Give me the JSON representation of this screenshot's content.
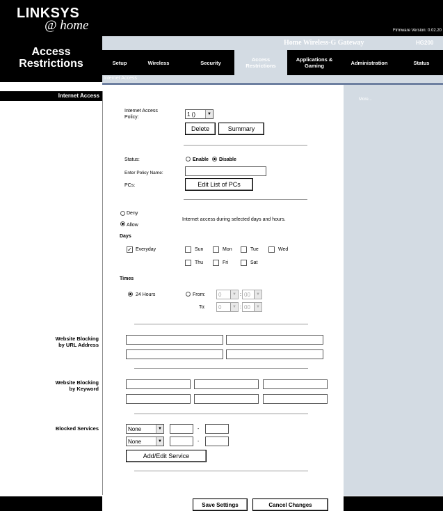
{
  "header": {
    "logo_main": "LINKSYS",
    "logo_sub": "@ home",
    "firmware": "Firmware Version: 0.02.20",
    "page_title_line1": "Access",
    "page_title_line2": "Restrictions",
    "gateway_name": "Home Wireless-G Gateway",
    "gateway_model": "HG200"
  },
  "nav": {
    "items": [
      "Setup",
      "Wireless",
      "Security",
      "Access Restrictions",
      "Applications & Gaming",
      "Administration",
      "Status"
    ],
    "active": "Access Restrictions",
    "subtab": "Internet Access"
  },
  "sidebar": {
    "more": "More..."
  },
  "section": {
    "title": "Internet Access",
    "policy_label": "Internet Access Policy:",
    "policy_value": "1 ()",
    "delete": "Delete",
    "summary": "Summary",
    "status_label": "Status:",
    "enable": "Enable",
    "disable": "Disable",
    "policy_name_label": "Enter Policy Name:",
    "policy_name_value": "",
    "pcs_label": "PCs:",
    "edit_pcs": "Edit List of PCs",
    "deny": "Deny",
    "allow": "Allow",
    "access_text": "Internet access during selected days and hours.",
    "days_label": "Days",
    "everyday": "Everyday",
    "days": [
      "Sun",
      "Mon",
      "Tue",
      "Wed",
      "Thu",
      "Fri",
      "Sat"
    ],
    "times_label": "Times",
    "hours24": "24 Hours",
    "from": "From:",
    "to": "To:",
    "from_hour": "0",
    "from_min": "00",
    "to_hour": "0",
    "to_min": "00"
  },
  "url_block": {
    "label_line1": "Website Blocking",
    "label_line2": "by URL Address"
  },
  "kw_block": {
    "label_line1": "Website Blocking",
    "label_line2": "by Keyword"
  },
  "services": {
    "label": "Blocked Services",
    "service1": "None",
    "service2": "None",
    "dash": "-",
    "add_edit": "Add/Edit Service"
  },
  "footer": {
    "save": "Save Settings",
    "cancel": "Cancel Changes"
  },
  "colors": {
    "accent": "#d3dbe3",
    "line": "#6d7fa0",
    "background": "#000000"
  }
}
